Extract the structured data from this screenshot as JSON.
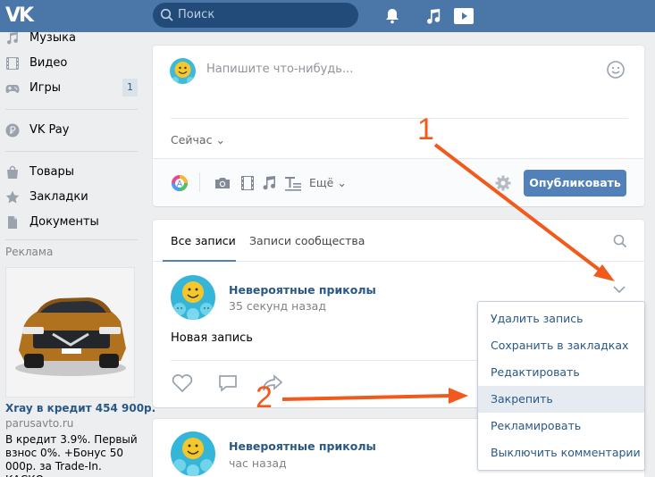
{
  "header": {
    "logo_text": "VK",
    "search_placeholder": "Поиск",
    "icons": [
      "bell-icon",
      "music-icon",
      "play-icon"
    ],
    "brand_color": "#4a76a8"
  },
  "leftnav": {
    "items": [
      {
        "label": "Музыка",
        "icon": "music-icon"
      },
      {
        "label": "Видео",
        "icon": "film-icon"
      },
      {
        "label": "Игры",
        "icon": "gamepad-icon",
        "count": "1"
      },
      {
        "label": "VK Pay",
        "icon": "ruble-icon"
      },
      {
        "label": "Товары",
        "icon": "bag-icon"
      },
      {
        "label": "Закладки",
        "icon": "star-icon"
      },
      {
        "label": "Документы",
        "icon": "document-icon"
      }
    ],
    "ad": {
      "title": "Реклама",
      "headline": "Xray в кредит 454 900р.",
      "source": "parusavto.ru",
      "text": "В кредит 3.9%. Первый взнос 0%. +Бонус 50 000р. за Trade-In. КАСКО"
    }
  },
  "composer": {
    "placeholder": "Напишите что-нибудь...",
    "when_label": "Сейчас",
    "more_label": "Ещё",
    "publish_label": "Опубликовать",
    "accent_color": "#5181b8"
  },
  "feed": {
    "tabs": [
      "Все записи",
      "Записи сообщества"
    ],
    "posts": [
      {
        "author": "Невероятные приколы",
        "time": "35 секунд назад",
        "text": "Новая запись"
      },
      {
        "author": "Невероятные приколы",
        "time": "час назад"
      }
    ]
  },
  "dropdown": {
    "items": [
      "Удалить запись",
      "Сохранить в закладках",
      "Редактировать",
      "Закрепить",
      "Рекламировать",
      "Выключить комментарии"
    ],
    "highlighted": "Закрепить"
  },
  "annotations": {
    "numbers": [
      "1",
      "2"
    ],
    "arrow_color": "#f05a1c"
  }
}
